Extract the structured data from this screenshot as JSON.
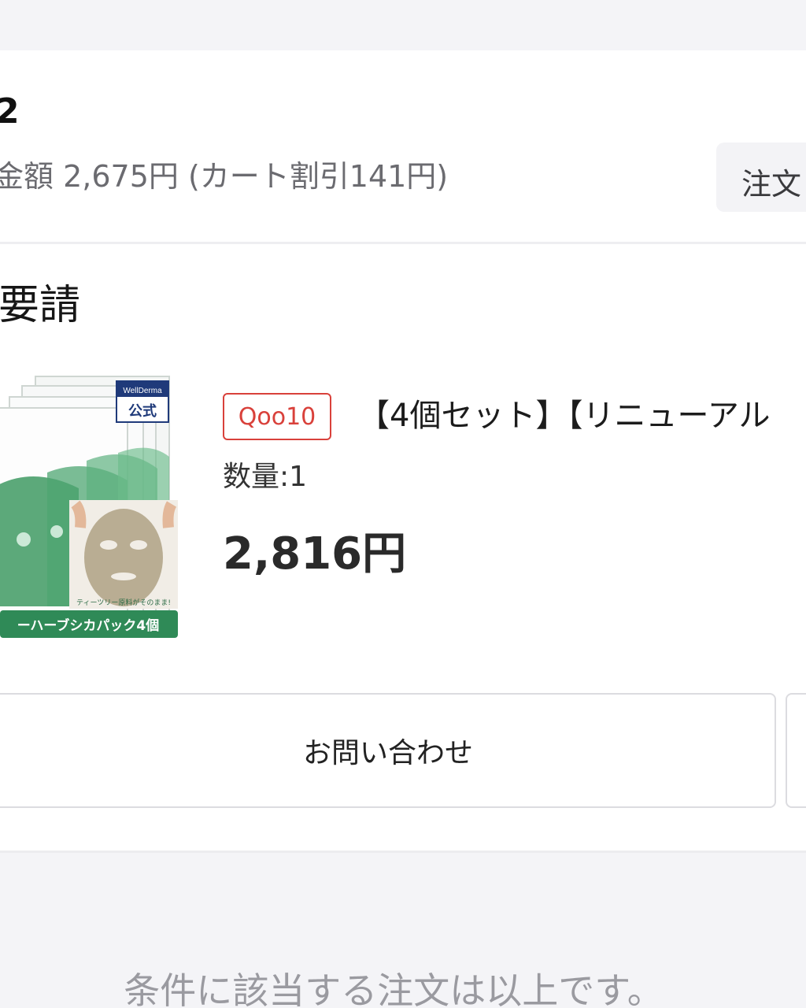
{
  "order": {
    "number": "2",
    "total_text": "金額 2,675円 (カート割引141円)",
    "detail_button_label": "注文"
  },
  "status": {
    "title": "要請"
  },
  "product": {
    "shop_badge": "Qoo10",
    "name": "【4個セット】【リニューアル",
    "quantity": "数量:1",
    "price": "2,816円",
    "image": {
      "brand": "WellDerma",
      "official_label": "公式",
      "caption": "ティーツリー原料がそのまま!",
      "banner": "ーハーブシカパック4個"
    }
  },
  "actions": {
    "contact_label": "お問い合わせ"
  },
  "footer": {
    "end_message": "条件に該当する注文は以上です。"
  },
  "colors": {
    "accent_red": "#d9413b",
    "product_green": "#3f9a63"
  }
}
